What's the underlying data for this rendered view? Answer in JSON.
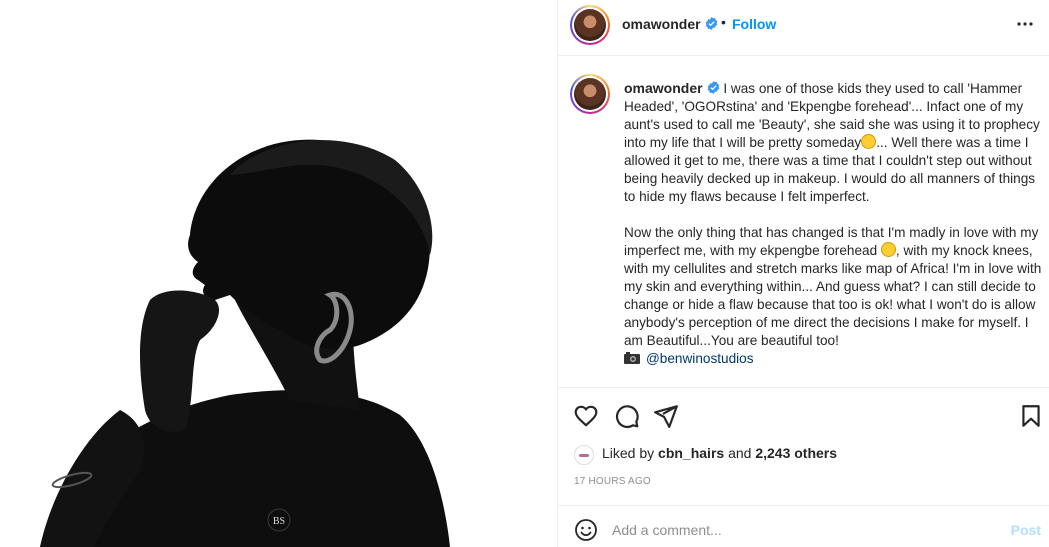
{
  "post": {
    "author": "omawonder",
    "follow_label": "Follow",
    "separator": "•",
    "photo_watermark": "BS"
  },
  "caption": {
    "username": "omawonder",
    "p1_a": "I was one of those kids they used to call 'Hammer Headed', 'OGORstina' and 'Ekpengbe forehead'... Infact one of my aunt's used to call me 'Beauty', she said she was using it to prophecy into my life that I will be pretty someday",
    "p1_b": "... Well there was a time I allowed it get to me, there was a time that I couldn't step out without being heavily decked up in makeup. I would do all manners of things to hide my flaws because I felt imperfect.",
    "p2_a": "Now the only thing that has changed is that I'm madly in love with my imperfect me, with my ekpengbe forehead ",
    "p2_b": ", with my knock knees, with my cellulites and stretch marks like map of Africa! I'm in love with my skin and everything within... And guess what? I can still decide to change or hide a flaw because that too is ok! what I won't do is allow anybody's perception of me direct the decisions I make for myself. I am Beautiful...You are beautiful too!",
    "credit_mention": "@benwinostudios"
  },
  "likes": {
    "prefix": "Liked by ",
    "first_user": "cbn_hairs",
    "middle": " and ",
    "others": "2,243 others"
  },
  "timestamp": "17 HOURS AGO",
  "comment": {
    "placeholder": "Add a comment...",
    "post_label": "Post"
  },
  "icons": {
    "verified": "verified-badge-icon",
    "more": "more-options-icon",
    "like": "heart-icon",
    "comment": "comment-icon",
    "share": "paper-plane-icon",
    "save": "bookmark-icon",
    "emoji": "smiley-icon",
    "camera": "camera-icon"
  },
  "colors": {
    "accent": "#0095f6",
    "verified": "#3897f0",
    "mention": "#00376b",
    "post_disabled": "#b2dffc",
    "muted": "#8e8e8e"
  }
}
